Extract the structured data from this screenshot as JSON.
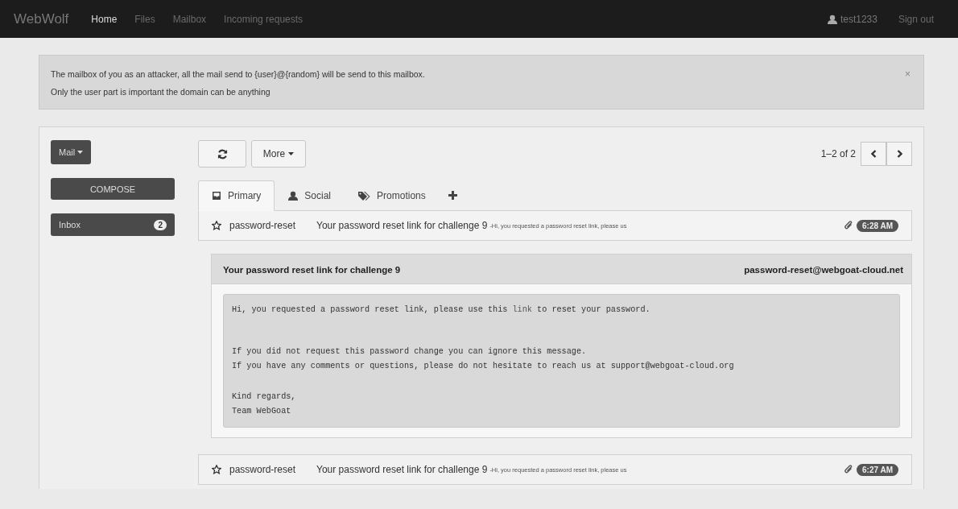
{
  "navbar": {
    "brand": "WebWolf",
    "items": [
      {
        "label": "Home",
        "selected": true
      },
      {
        "label": "Files",
        "selected": false
      },
      {
        "label": "Mailbox",
        "selected": false
      },
      {
        "label": "Incoming requests",
        "selected": false
      }
    ],
    "user": "test1233",
    "sign_out": "Sign out"
  },
  "alert": {
    "lines": [
      "The mailbox of you as an attacker, all the mail send to {user}@{random} will be send to this mailbox.",
      "Only the user part is important the domain can be anything"
    ],
    "close": "×"
  },
  "sidebar": {
    "mail_button": "Mail",
    "compose_button": "COMPOSE",
    "inbox": {
      "label": "Inbox",
      "count": "2"
    }
  },
  "toolbar": {
    "more_button": "More",
    "pager": "1–2 of 2"
  },
  "tabs": [
    {
      "label": "Primary",
      "selected": true
    },
    {
      "label": "Social",
      "selected": false
    },
    {
      "label": "Promotions",
      "selected": false
    }
  ],
  "emails": [
    {
      "sender": "password-reset",
      "subject": "Your password reset link for challenge 9",
      "preview": "-Hi, you requested a password reset link, please us",
      "time": "6:28 AM",
      "expanded": true,
      "message": {
        "title": "Your password reset link for challenge 9",
        "from": "password-reset@webgoat-cloud.net",
        "paragraphs": [
          {
            "lines": [
              {
                "before": "Hi, you requested a password reset link, please use this ",
                "link": "link",
                "after": " to reset your password."
              }
            ]
          },
          {
            "lines": [
              {
                "before": "If you did not request this password change you can ignore this message."
              },
              {
                "before": "If you have any comments or questions, please do not hesitate to reach us at support@webgoat-cloud.org"
              }
            ]
          },
          {
            "lines": [
              {
                "before": "Kind regards,"
              },
              {
                "before": "Team WebGoat"
              }
            ]
          }
        ]
      }
    },
    {
      "sender": "password-reset",
      "subject": "Your password reset link for challenge 9",
      "preview": "-Hi, you requested a password reset link, please us",
      "time": "6:27 AM",
      "expanded": false
    }
  ]
}
